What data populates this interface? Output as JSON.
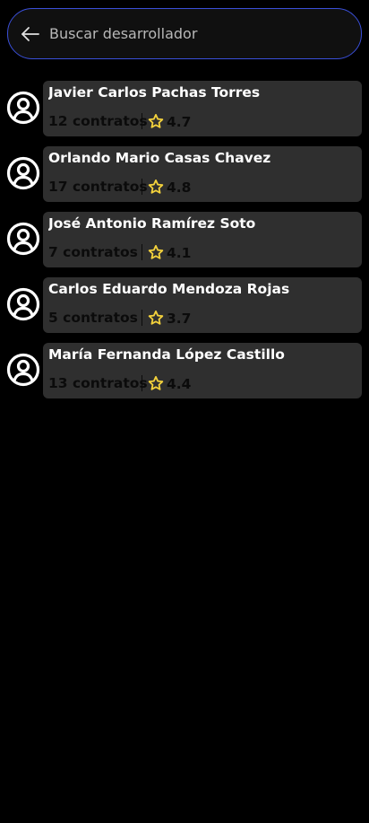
{
  "colors": {
    "background": "#000000",
    "card": "#2f2f2f",
    "search_border": "#3a4fd8",
    "star": "#f4d23c",
    "name_text": "#ffffff",
    "meta_text": "#0b0b0b"
  },
  "search": {
    "back_icon": "arrow-left-icon",
    "placeholder": "Buscar desarrollador",
    "value": ""
  },
  "developers": [
    {
      "name": "Javier Carlos Pachas Torres",
      "contracts": "12 contratos",
      "rating": "4.7",
      "avatar_icon": "user-circle-icon",
      "rating_icon": "star-icon"
    },
    {
      "name": "Orlando Mario Casas Chavez",
      "contracts": "17 contratos",
      "rating": "4.8",
      "avatar_icon": "user-circle-icon",
      "rating_icon": "star-icon"
    },
    {
      "name": "José Antonio Ramírez Soto",
      "contracts": "7 contratos",
      "rating": "4.1",
      "avatar_icon": "user-circle-icon",
      "rating_icon": "star-icon"
    },
    {
      "name": "Carlos Eduardo Mendoza Rojas",
      "contracts": "5 contratos",
      "rating": "3.7",
      "avatar_icon": "user-circle-icon",
      "rating_icon": "star-icon"
    },
    {
      "name": "María Fernanda López Castillo",
      "contracts": "13 contratos",
      "rating": "4.4",
      "avatar_icon": "user-circle-icon",
      "rating_icon": "star-icon"
    }
  ]
}
